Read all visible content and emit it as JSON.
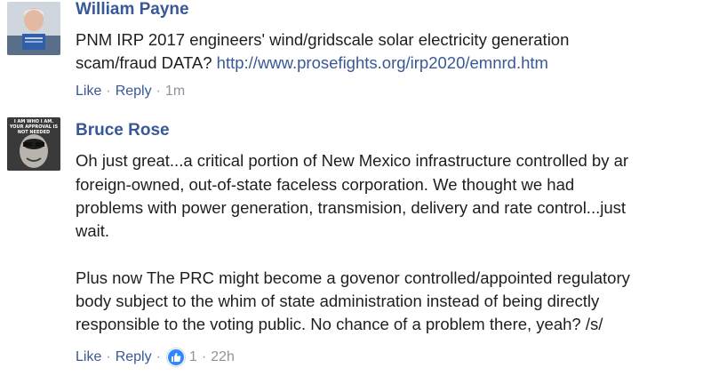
{
  "comments": [
    {
      "author": "William Payne",
      "text_lines": [
        "PNM IRP 2017 engineers' wind/gridscale solar electricity generation"
      ],
      "text_prefix_line2": "scam/fraud DATA? ",
      "link_text": "http://www.prosefights.org/irp2020/emnrd.htm",
      "actions": {
        "like": "Like",
        "reply": "Reply",
        "time": "1m"
      }
    },
    {
      "author": "Bruce Rose",
      "avatar_caption": "I AM WHO I AM. YOUR APPROVAL IS NOT NEEDED",
      "text_lines": [
        "Oh just great...a critical portion of New Mexico infrastructure controlled by ar",
        "foreign-owned, out-of-state faceless corporation. We thought we had",
        "problems with power generation, transmision, delivery and rate control...just",
        "wait.",
        "Plus now The PRC might become a govenor controlled/appointed regulatory",
        "body subject to the whim of state administration instead of being directly",
        "responsible to the voting public. No chance of a problem there, yeah? /s/"
      ],
      "actions": {
        "like": "Like",
        "reply": "Reply",
        "reaction_count": "1",
        "time": "22h"
      }
    }
  ],
  "colors": {
    "link": "#385898",
    "text": "#1c1e21",
    "meta": "#90949c",
    "like_badge": "#2d88ff"
  }
}
